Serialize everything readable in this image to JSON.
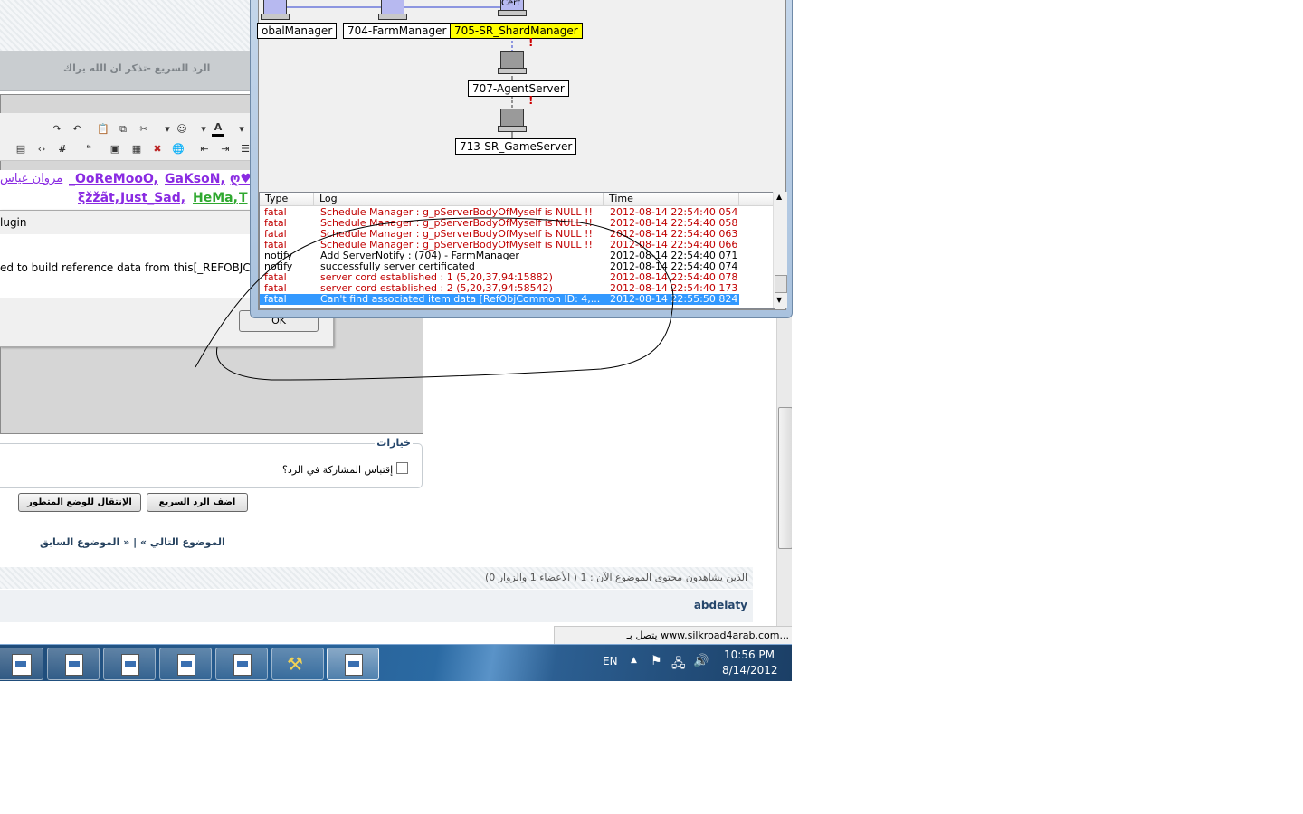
{
  "forum": {
    "quick_reply_title": "الرد السريع -تذكر ان الله يراك",
    "users_row1": [
      "مروان عياس",
      "_OoReMooO,",
      "GaKsoN,",
      "ღ♥"
    ],
    "users_row2": [
      "ξžžãt,",
      "Just_Sad,",
      "HeMa,",
      "T"
    ],
    "plugin_text": "lugin",
    "error_text": "ed to build reference data from this[_REFOBJCOMMO",
    "ok_label": "OK",
    "options_legend": "خيارات",
    "quote_checkbox_label": "إقتباس المشاركة في الرد؟",
    "advanced_mode_button": "الإنتقال للوضع المتطور",
    "add_quick_reply_button": "اضف الرد السريع",
    "prev_topic": "« الموضوع السابق",
    "separator": "|",
    "next_topic": "الموضوع التالي »",
    "viewers_text": "الذين يشاهدون محتوى الموضوع الآن : 1 ( الأعضاء 1 والزوار 0)",
    "online_user": "abdelaty",
    "status_text": "يتصل بـ www.silkroad4arab.com..."
  },
  "server_window": {
    "nodes": {
      "global": "obalManager",
      "farm": "704-FarmManager",
      "shard": "705-SR_ShardManager",
      "agent": "707-AgentServer",
      "game": "713-SR_GameServer",
      "cert": "Cert"
    },
    "log": {
      "headers": [
        "Type",
        "Log",
        "Time"
      ],
      "rows": [
        {
          "type": "fatal",
          "log": "Schedule Manager : g_pServerBodyOfMyself is NULL !!",
          "time": "2012-08-14 22:54:40 054"
        },
        {
          "type": "fatal",
          "log": "Schedule Manager : g_pServerBodyOfMyself is NULL !!",
          "time": "2012-08-14 22:54:40 058"
        },
        {
          "type": "fatal",
          "log": "Schedule Manager : g_pServerBodyOfMyself is NULL !!",
          "time": "2012-08-14 22:54:40 063"
        },
        {
          "type": "fatal",
          "log": "Schedule Manager : g_pServerBodyOfMyself is NULL !!",
          "time": "2012-08-14 22:54:40 066"
        },
        {
          "type": "notify",
          "log": "Add ServerNotify : (704) - FarmManager",
          "time": "2012-08-14 22:54:40 071"
        },
        {
          "type": "notify",
          "log": "successfully server certificated",
          "time": "2012-08-14 22:54:40 074"
        },
        {
          "type": "fatal",
          "log": "server cord established : 1 (5,20,37,94:15882)",
          "time": "2012-08-14 22:54:40 078"
        },
        {
          "type": "fatal",
          "log": "server cord established : 2 (5,20,37,94:58542)",
          "time": "2012-08-14 22:54:40 173"
        },
        {
          "type": "fatal",
          "log": "Can't find associated item data [RefObjCommon ID: 4,...",
          "time": "2012-08-14 22:55:50 824"
        }
      ]
    }
  },
  "taskbar": {
    "language": "EN",
    "time": "10:56 PM",
    "date": "8/14/2012"
  },
  "colors": {
    "fatal_text": "#c00000",
    "selected_row": "#3399ff",
    "shard_highlight": "#ffff00",
    "user_purple": "#8a2be2",
    "user_green": "#2fa82f"
  }
}
